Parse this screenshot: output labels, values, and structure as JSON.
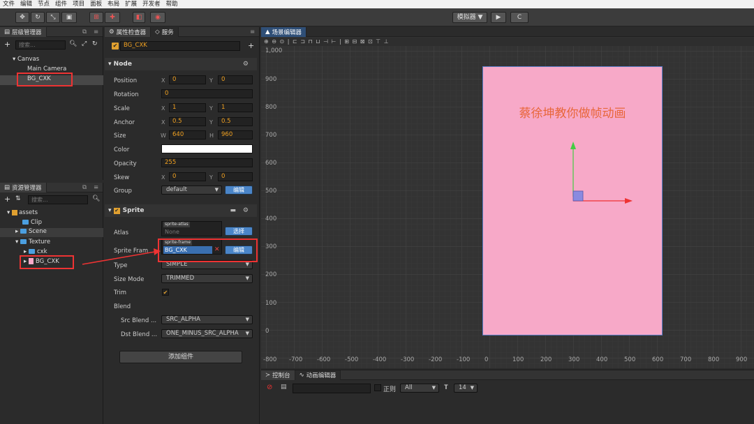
{
  "menu": [
    "文件",
    "编辑",
    "节点",
    "组件",
    "项目",
    "面板",
    "布局",
    "扩展",
    "开发者",
    "帮助"
  ],
  "toolbar": {
    "simulator_label": "模拟器 ▼",
    "play_icon": "▶",
    "refresh_icon": "C"
  },
  "hierarchy": {
    "tab": "层级管理器",
    "search_placeholder": "搜索...",
    "items": [
      "Canvas",
      "Main Camera",
      "BG_CXK"
    ]
  },
  "assets": {
    "tab": "资源管理器",
    "search_placeholder": "搜索...",
    "items": [
      "assets",
      "Clip",
      "Scene",
      "Texture",
      "cxk",
      "BG_CXK"
    ]
  },
  "inspector": {
    "tab": "属性检查器",
    "tab2": "服务",
    "node_name": "BG_CXK",
    "node_section": "Node",
    "position": {
      "label": "Position",
      "x": "0",
      "y": "0"
    },
    "rotation": {
      "label": "Rotation",
      "value": "0"
    },
    "scale": {
      "label": "Scale",
      "x": "1",
      "y": "1"
    },
    "anchor": {
      "label": "Anchor",
      "x": "0.5",
      "y": "0.5"
    },
    "size": {
      "label": "Size",
      "w": "640",
      "h": "960"
    },
    "color": {
      "label": "Color"
    },
    "opacity": {
      "label": "Opacity",
      "value": "255"
    },
    "skew": {
      "label": "Skew",
      "x": "0",
      "y": "0"
    },
    "group": {
      "label": "Group",
      "value": "default",
      "edit": "编辑"
    },
    "sprite_section": "Sprite",
    "atlas": {
      "label": "Atlas",
      "tag": "sprite-atlas",
      "value": "None",
      "btn": "选择"
    },
    "sprite_frame": {
      "label": "Sprite Fram",
      "tag": "sprite-frame",
      "value": "BG_CXK",
      "btn": "编辑"
    },
    "type": {
      "label": "Type",
      "value": "SIMPLE"
    },
    "size_mode": {
      "label": "Size Mode",
      "value": "TRIMMED"
    },
    "trim": {
      "label": "Trim"
    },
    "blend": {
      "label": "Blend"
    },
    "src_blend": {
      "label": "Src Blend ...",
      "value": "SRC_ALPHA"
    },
    "dst_blend": {
      "label": "Dst Blend ...",
      "value": "ONE_MINUS_SRC_ALPHA"
    },
    "add_component": "添加组件",
    "xy_labels": {
      "x": "X",
      "y": "Y",
      "w": "W",
      "h": "H"
    }
  },
  "scene": {
    "tab": "场景编辑器",
    "canvas_text": "蔡徐坤教你做帧动画",
    "y_ticks": [
      "1,000",
      "900",
      "800",
      "700",
      "600",
      "500",
      "400",
      "300",
      "200",
      "100",
      "0"
    ],
    "x_ticks": [
      "-800",
      "-700",
      "-600",
      "-500",
      "-400",
      "-300",
      "-200",
      "-100",
      "0",
      "100",
      "200",
      "300",
      "400",
      "500",
      "600",
      "700",
      "800",
      "900"
    ],
    "corner_label": "-800"
  },
  "console": {
    "tab1": "控制台",
    "tab2": "动画编辑器",
    "regex_label": "正则",
    "filter": "All",
    "font_size": "14"
  },
  "colors": {
    "sprite_bg": "#f7a9c8",
    "accent": "#2f4f77",
    "highlight": "#e33333"
  }
}
